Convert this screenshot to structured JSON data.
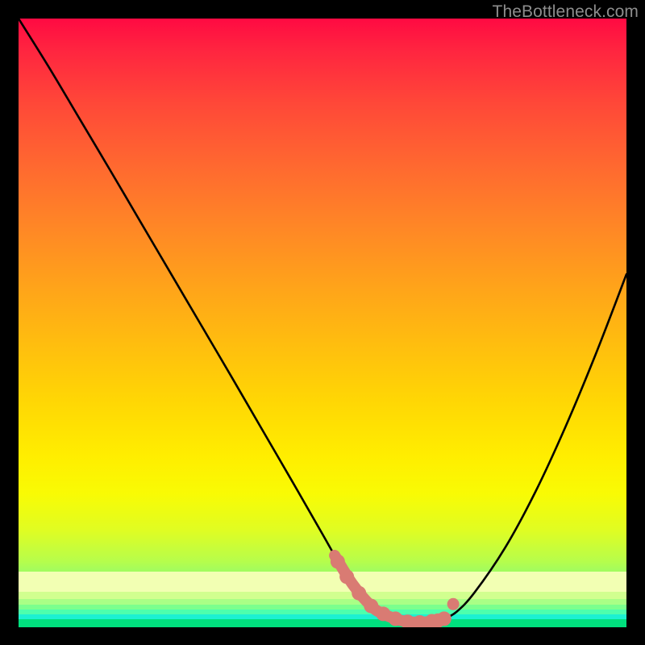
{
  "watermark": {
    "text": "TheBottleneck.com"
  },
  "colors": {
    "frame": "#000000",
    "curve_stroke": "#000000",
    "highlight_stroke": "#d97b73",
    "highlight_fill": "#d97b73",
    "gradient_top": "#ff0a42",
    "gradient_bottom": "#03eae8",
    "bottom_band": "#00e07e"
  },
  "chart_data": {
    "type": "line",
    "title": "",
    "xlabel": "",
    "ylabel": "",
    "xlim": [
      0,
      100
    ],
    "ylim": [
      0,
      100
    ],
    "grid": false,
    "legend": false,
    "series": [
      {
        "name": "bottleneck-curve",
        "x": [
          0,
          5,
          10,
          15,
          20,
          25,
          30,
          35,
          40,
          45,
          50,
          52,
          55,
          58,
          60,
          63,
          66,
          69,
          70,
          72,
          75,
          80,
          85,
          90,
          95,
          100
        ],
        "y": [
          100,
          92,
          83.6,
          75.2,
          66.7,
          58.2,
          49.7,
          41.2,
          32.6,
          24.0,
          15.3,
          11.8,
          7.0,
          3.5,
          2.2,
          1.1,
          0.8,
          1.1,
          1.4,
          2.5,
          5.7,
          13.0,
          22.2,
          33.0,
          45.0,
          58.0
        ]
      }
    ],
    "highlight_segment": {
      "x": [
        52,
        55,
        58,
        60,
        63,
        66,
        69,
        70
      ],
      "y": [
        11.8,
        7.0,
        3.5,
        2.2,
        1.1,
        0.8,
        1.1,
        1.4
      ]
    },
    "highlight_markers": {
      "x": [
        52.5,
        54,
        56,
        58,
        60,
        62,
        64,
        66,
        68,
        69,
        70
      ],
      "y": [
        10.8,
        8.3,
        5.6,
        3.5,
        2.2,
        1.4,
        0.9,
        0.8,
        1.0,
        1.1,
        1.4
      ]
    },
    "extra_marker": {
      "x": 71.5,
      "y": 3.8
    }
  }
}
